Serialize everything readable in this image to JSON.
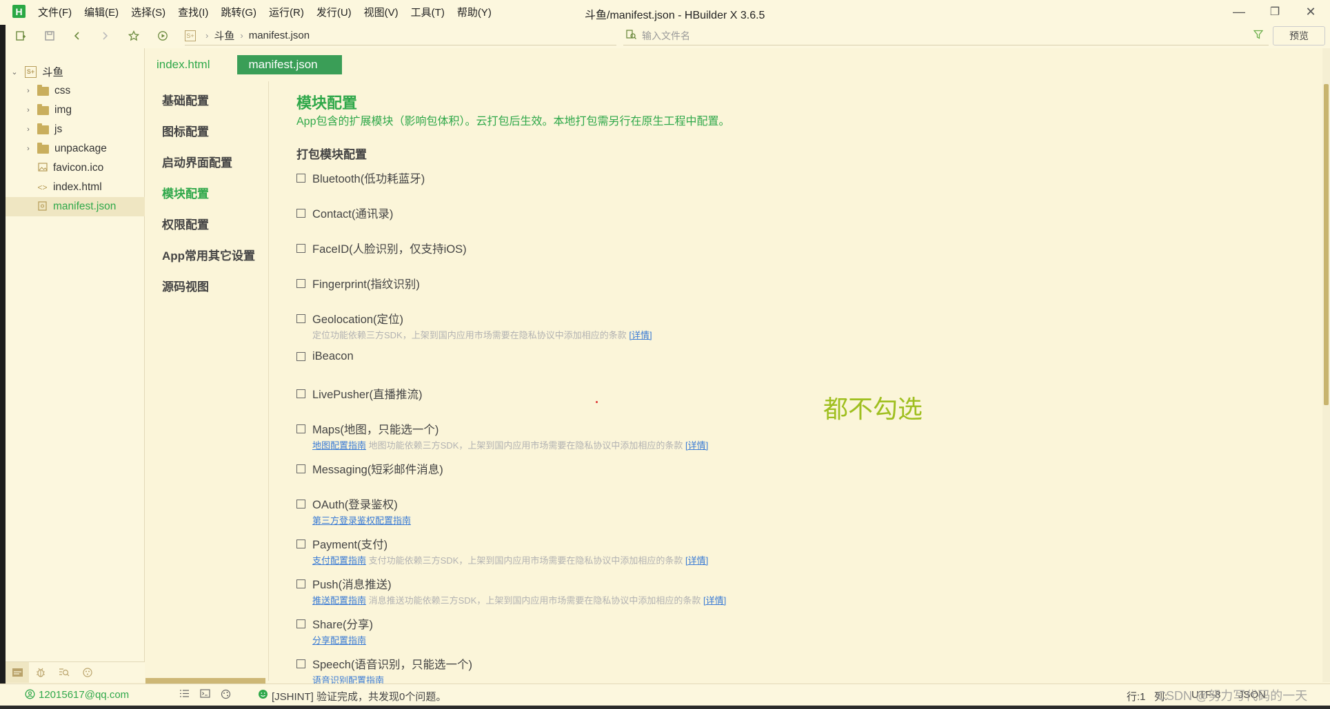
{
  "app": {
    "logo": "H",
    "window_title": "斗鱼/manifest.json - HBuilder X 3.6.5",
    "menus": [
      "文件(F)",
      "编辑(E)",
      "选择(S)",
      "查找(I)",
      "跳转(G)",
      "运行(R)",
      "发行(U)",
      "视图(V)",
      "工具(T)",
      "帮助(Y)"
    ],
    "window_controls": {
      "minimize": "—",
      "maximize": "❐",
      "close": "✕"
    }
  },
  "toolbar": {
    "breadcrumb": [
      "斗鱼",
      "manifest.json"
    ],
    "breadcrumb_logo": "S+",
    "search_placeholder": "输入文件名",
    "preview_label": "预览"
  },
  "project_tree": {
    "root": {
      "label": "斗鱼",
      "icon": "S+"
    },
    "items": [
      {
        "label": "css",
        "type": "folder"
      },
      {
        "label": "img",
        "type": "folder"
      },
      {
        "label": "js",
        "type": "folder"
      },
      {
        "label": "unpackage",
        "type": "folder"
      },
      {
        "label": "favicon.ico",
        "type": "image-file"
      },
      {
        "label": "index.html",
        "type": "code-file"
      },
      {
        "label": "manifest.json",
        "type": "json-file",
        "selected": true
      }
    ]
  },
  "editor_tabs": [
    {
      "label": "index.html",
      "active": false
    },
    {
      "label": "manifest.json",
      "active": true
    }
  ],
  "config_nav": [
    {
      "label": "基础配置",
      "active": false
    },
    {
      "label": "图标配置",
      "active": false
    },
    {
      "label": "启动界面配置",
      "active": false
    },
    {
      "label": "模块配置",
      "active": true
    },
    {
      "label": "权限配置",
      "active": false
    },
    {
      "label": "App常用其它设置",
      "active": false
    },
    {
      "label": "源码视图",
      "active": false
    }
  ],
  "content": {
    "title": "模块配置",
    "description": "App包含的扩展模块（影响包体积）。云打包后生效。本地打包需另行在原生工程中配置。",
    "subtitle": "打包模块配置",
    "modules": [
      {
        "label": "Bluetooth(低功耗蓝牙)",
        "checked": false
      },
      {
        "label": "Contact(通讯录)",
        "checked": false
      },
      {
        "label": "FaceID(人脸识别，仅支持iOS)",
        "checked": false
      },
      {
        "label": "Fingerprint(指纹识别)",
        "checked": false
      },
      {
        "label": "Geolocation(定位)",
        "checked": false,
        "note": "定位功能依赖三方SDK，上架到国内应用市场需要在隐私协议中添加相应的条款",
        "note_link": "[详情]"
      },
      {
        "label": "iBeacon",
        "checked": false
      },
      {
        "label": "LivePusher(直播推流)",
        "checked": false
      },
      {
        "label": "Maps(地图，只能选一个)",
        "checked": false,
        "guide_link": "地图配置指南",
        "note": "地图功能依赖三方SDK，上架到国内应用市场需要在隐私协议中添加相应的条款",
        "note_link": "[详情]"
      },
      {
        "label": "Messaging(短彩邮件消息)",
        "checked": false
      },
      {
        "label": "OAuth(登录鉴权)",
        "checked": false,
        "guide_link": "第三方登录鉴权配置指南"
      },
      {
        "label": "Payment(支付)",
        "checked": false,
        "guide_link": "支付配置指南",
        "note": "支付功能依赖三方SDK，上架到国内应用市场需要在隐私协议中添加相应的条款",
        "note_link": "[详情]"
      },
      {
        "label": "Push(消息推送)",
        "checked": false,
        "guide_link": "推送配置指南",
        "note": "消息推送功能依赖三方SDK，上架到国内应用市场需要在隐私协议中添加相应的条款",
        "note_link": "[详情]"
      },
      {
        "label": "Share(分享)",
        "checked": false,
        "guide_link": "分享配置指南"
      },
      {
        "label": "Speech(语音识别，只能选一个)",
        "checked": false,
        "guide_link": "语音识别配置指南"
      }
    ],
    "annotation": "都不勾选"
  },
  "statusbar": {
    "user": "12015617@qq.com",
    "message": "[JSHINT] 验证完成，共发现0个问题。",
    "line": "行:1",
    "col": "列:",
    "encoding": "UTF-8",
    "language": "JSON"
  },
  "watermark": "CSDN @努力写代码的一天",
  "colors": {
    "accent": "#2fa84a",
    "background": "#fbf5d9",
    "active_tab": "#3a9e57",
    "annotation": "#9fbf1f",
    "link": "#3a7bd5"
  }
}
